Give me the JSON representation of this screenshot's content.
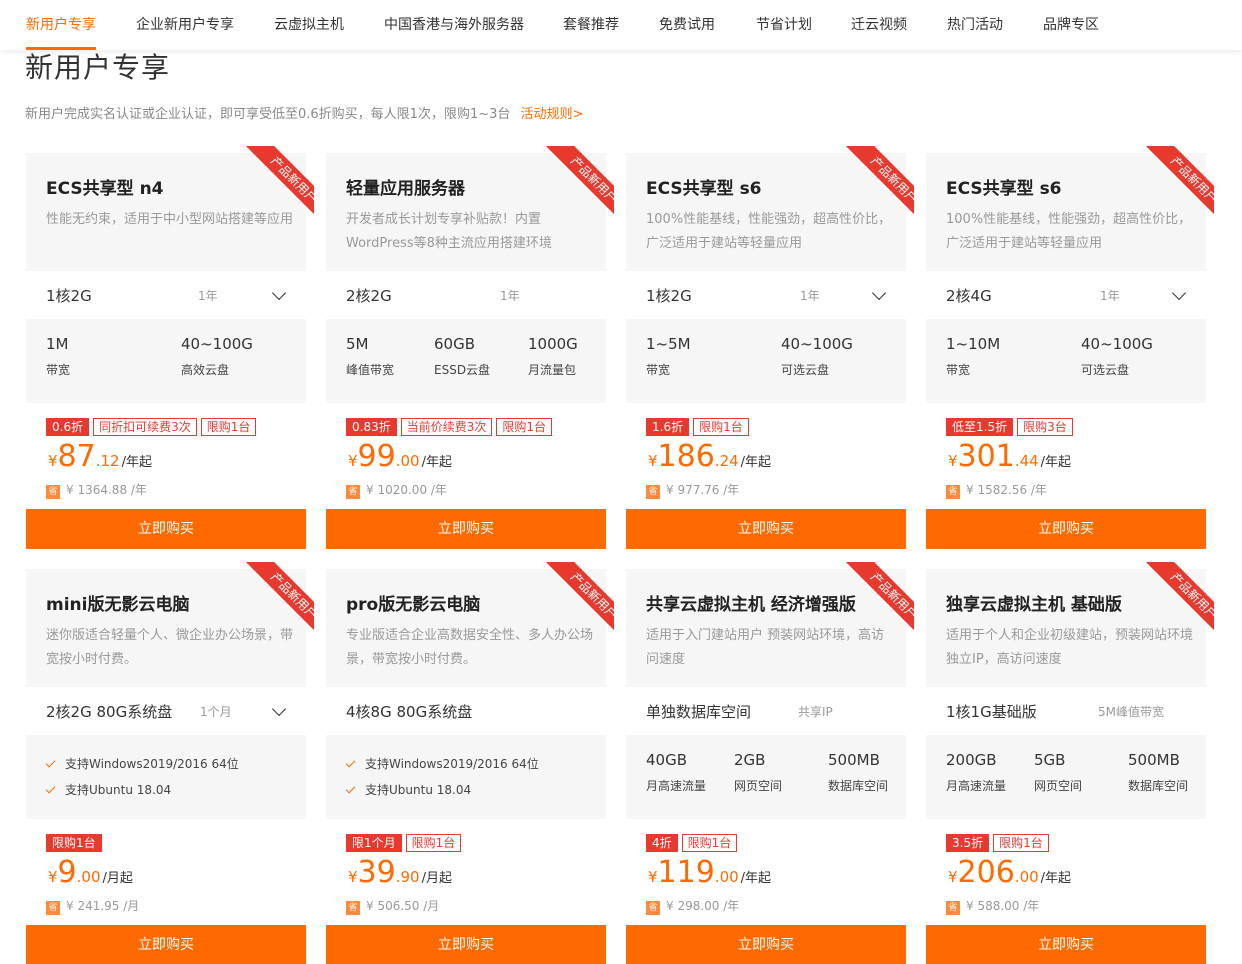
{
  "nav": {
    "items": [
      "新用户专享",
      "企业新用户专享",
      "云虚拟主机",
      "中国香港与海外服务器",
      "套餐推荐",
      "免费试用",
      "节省计划",
      "迁云视频",
      "热门活动",
      "品牌专区"
    ]
  },
  "page": {
    "title": "新用户专享",
    "intro": "新用户完成实名认证或企业认证，即可享受低至0.6折购买，每人限1次，限购1~3台",
    "rules_link": "活动规则>"
  },
  "ribbon_text": "产品新用户",
  "buy_label": "立即购买",
  "save_badge": "省",
  "colors": {
    "accent": "#ff6a00",
    "tag_red": "#e8392f"
  },
  "cards": [
    {
      "title": "ECS共享型 n4",
      "desc": "性能无约束，适用于中小型网站搭建等应用",
      "spec": "1核2G",
      "duration": "1年",
      "has_dropdown": true,
      "attrs": [
        {
          "value": "1M",
          "label": "带宽"
        },
        {
          "value": "40~100G",
          "label": "高效云盘"
        }
      ],
      "features": [],
      "tags": [
        {
          "text": "0.6折",
          "fill": true
        },
        {
          "text": "同折扣可续费3次",
          "fill": false
        },
        {
          "text": "限购1台",
          "fill": false
        }
      ],
      "price": {
        "int": "87",
        "dec": ".12",
        "unit": "/年起"
      },
      "original": "¥ 1364.88 /年"
    },
    {
      "title": "轻量应用服务器",
      "desc": "开发者成长计划专享补贴款！内置WordPress等8种主流应用搭建环境",
      "spec": "2核2G",
      "duration": "1年",
      "has_dropdown": false,
      "attrs": [
        {
          "value": "5M",
          "label": "峰值带宽"
        },
        {
          "value": "60GB",
          "label": "ESSD云盘"
        },
        {
          "value": "1000G",
          "label": "月流量包"
        }
      ],
      "features": [],
      "tags": [
        {
          "text": "0.83折",
          "fill": true
        },
        {
          "text": "当前价续费3次",
          "fill": false
        },
        {
          "text": "限购1台",
          "fill": false
        }
      ],
      "price": {
        "int": "99",
        "dec": ".00",
        "unit": "/年起"
      },
      "original": "¥ 1020.00 /年"
    },
    {
      "title": "ECS共享型 s6",
      "desc": "100%性能基线，性能强劲，超高性价比，广泛适用于建站等轻量应用",
      "spec": "1核2G",
      "duration": "1年",
      "has_dropdown": true,
      "attrs": [
        {
          "value": "1~5M",
          "label": "带宽"
        },
        {
          "value": "40~100G",
          "label": "可选云盘"
        }
      ],
      "features": [],
      "tags": [
        {
          "text": "1.6折",
          "fill": true
        },
        {
          "text": "限购1台",
          "fill": false
        }
      ],
      "price": {
        "int": "186",
        "dec": ".24",
        "unit": "/年起"
      },
      "original": "¥ 977.76 /年"
    },
    {
      "title": "ECS共享型 s6",
      "desc": "100%性能基线，性能强劲，超高性价比，广泛适用于建站等轻量应用",
      "spec": "2核4G",
      "duration": "1年",
      "has_dropdown": true,
      "attrs": [
        {
          "value": "1~10M",
          "label": "带宽"
        },
        {
          "value": "40~100G",
          "label": "可选云盘"
        }
      ],
      "features": [],
      "tags": [
        {
          "text": "低至1.5折",
          "fill": true
        },
        {
          "text": "限购3台",
          "fill": false
        }
      ],
      "price": {
        "int": "301",
        "dec": ".44",
        "unit": "/年起"
      },
      "original": "¥ 1582.56 /年"
    },
    {
      "title": "mini版无影云电脑",
      "desc": "迷你版适合轻量个人、微企业办公场景，带宽按小时付费。",
      "spec": "2核2G 80G系统盘",
      "duration": "1个月",
      "has_dropdown": true,
      "attrs": [],
      "features": [
        "支持Windows2019/2016 64位",
        "支持Ubuntu 18.04"
      ],
      "tags": [
        {
          "text": "限购1台",
          "fill": true
        }
      ],
      "price": {
        "int": "9",
        "dec": ".00",
        "unit": "/月起"
      },
      "original": "¥ 241.95 /月"
    },
    {
      "title": "pro版无影云电脑",
      "desc": "专业版适合企业高数据安全性、多人办公场景，带宽按小时付费。",
      "spec": "4核8G 80G系统盘",
      "duration": "",
      "has_dropdown": false,
      "attrs": [],
      "features": [
        "支持Windows2019/2016 64位",
        "支持Ubuntu 18.04"
      ],
      "tags": [
        {
          "text": "限1个月",
          "fill": true
        },
        {
          "text": "限购1台",
          "fill": false
        }
      ],
      "price": {
        "int": "39",
        "dec": ".90",
        "unit": "/月起"
      },
      "original": "¥ 506.50 /月"
    },
    {
      "title": "共享云虚拟主机 经济增强版",
      "desc": "适用于入门建站用户 预装网站环境，高访问速度",
      "spec": "单独数据库空间",
      "duration": "共享IP",
      "has_dropdown": false,
      "attrs": [
        {
          "value": "40GB",
          "label": "月高速流量"
        },
        {
          "value": "2GB",
          "label": "网页空间"
        },
        {
          "value": "500MB",
          "label": "数据库空间"
        }
      ],
      "features": [],
      "tags": [
        {
          "text": "4折",
          "fill": true
        },
        {
          "text": "限购1台",
          "fill": false
        }
      ],
      "price": {
        "int": "119",
        "dec": ".00",
        "unit": "/年起"
      },
      "original": "¥ 298.00 /年"
    },
    {
      "title": "独享云虚拟主机 基础版",
      "desc": "适用于个人和企业初级建站，预装网站环境独立IP，高访问速度",
      "spec": "1核1G基础版",
      "duration": "5M峰值带宽",
      "has_dropdown": false,
      "attrs": [
        {
          "value": "200GB",
          "label": "月高速流量"
        },
        {
          "value": "5GB",
          "label": "网页空间"
        },
        {
          "value": "500MB",
          "label": "数据库空间"
        }
      ],
      "features": [],
      "tags": [
        {
          "text": "3.5折",
          "fill": true
        },
        {
          "text": "限购1台",
          "fill": false
        }
      ],
      "price": {
        "int": "206",
        "dec": ".00",
        "unit": "/年起"
      },
      "original": "¥ 588.00 /年"
    }
  ]
}
